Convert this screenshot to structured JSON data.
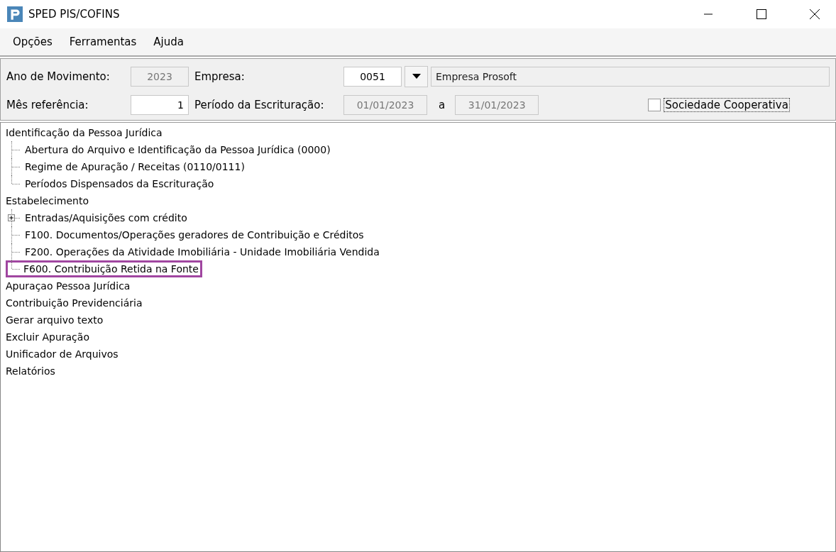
{
  "window": {
    "title": "SPED PIS/COFINS"
  },
  "menu": [
    "Opções",
    "Ferramentas",
    "Ajuda"
  ],
  "form": {
    "ano_label": "Ano de Movimento:",
    "ano_value": "2023",
    "ano_disabled": true,
    "empresa_label": "Empresa:",
    "empresa_code": "0051",
    "empresa_name": "Empresa Prosoft",
    "mes_label": "Mês referência:",
    "mes_value": "1",
    "periodo_label": "Período da Escrituração:",
    "periodo_start": "01/01/2023",
    "periodo_sep": "a",
    "periodo_end": "31/01/2023",
    "cooperativa": {
      "label": "Sociedade Cooperativa",
      "checked": false
    }
  },
  "tree": [
    {
      "label": "Identificação da Pessoa Jurídica",
      "children": [
        {
          "label": "Abertura do Arquivo e Identificação da Pessoa Jurídica (0000)",
          "collapsed": false,
          "highlighted": false
        },
        {
          "label": "Regime de Apuração / Receitas (0110/0111)",
          "collapsed": false,
          "highlighted": false
        },
        {
          "label": "Períodos Dispensados da Escrituração",
          "collapsed": false,
          "highlighted": false
        }
      ]
    },
    {
      "label": "Estabelecimento",
      "children": [
        {
          "label": "Entradas/Aquisições com crédito",
          "collapsed": true,
          "highlighted": false
        },
        {
          "label": "F100. Documentos/Operações geradores de Contribuição e Créditos",
          "collapsed": false,
          "highlighted": false
        },
        {
          "label": "F200. Operações da Atividade Imobiliária - Unidade Imobiliária Vendida",
          "collapsed": false,
          "highlighted": false
        },
        {
          "label": "F600. Contribuição Retida na Fonte",
          "collapsed": false,
          "highlighted": true
        }
      ]
    },
    {
      "label": "Apuraçao Pessoa Jurídica"
    },
    {
      "label": "Contribuição Previdenciária"
    },
    {
      "label": "Gerar arquivo texto"
    },
    {
      "label": "Excluir Apuração"
    },
    {
      "label": "Unificador de Arquivos"
    },
    {
      "label": "Relatórios"
    }
  ]
}
